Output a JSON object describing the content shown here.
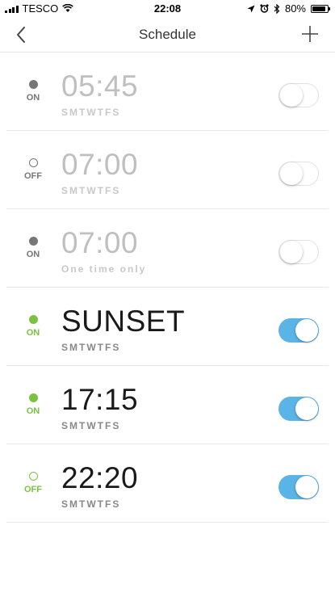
{
  "status_bar": {
    "carrier": "TESCO",
    "time": "22:08",
    "battery": "80%"
  },
  "nav": {
    "title": "Schedule"
  },
  "schedules": [
    {
      "time": "05:45",
      "days": "SMTWTFS",
      "status": "ON",
      "dot": "filled",
      "active": false,
      "toggle": false
    },
    {
      "time": "07:00",
      "days": "SMTWTFS",
      "status": "OFF",
      "dot": "hollow",
      "active": false,
      "toggle": false
    },
    {
      "time": "07:00",
      "days": "One time only",
      "status": "ON",
      "dot": "filled",
      "active": false,
      "toggle": false
    },
    {
      "time": "SUNSET",
      "days": "SMTWTFS",
      "status": "ON",
      "dot": "filled",
      "active": true,
      "toggle": true
    },
    {
      "time": "17:15",
      "days": "SMTWTFS",
      "status": "ON",
      "dot": "filled",
      "active": true,
      "toggle": true
    },
    {
      "time": "22:20",
      "days": "SMTWTFS",
      "status": "OFF",
      "dot": "hollow",
      "active": true,
      "toggle": true
    }
  ],
  "colors": {
    "active_status": "#7cc242",
    "inactive_status": "#777777",
    "toggle_on": "#5ab4e5"
  }
}
